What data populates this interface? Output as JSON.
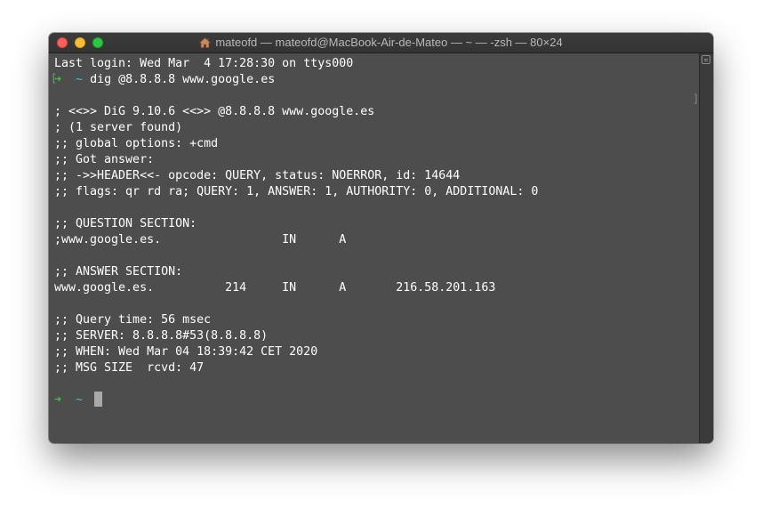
{
  "window": {
    "title": "mateofd — mateofd@MacBook-Air-de-Mateo — ~ — -zsh — 80×24",
    "title_icon": "home-icon"
  },
  "colors": {
    "background": "#4d4d4d",
    "text": "#ffffff",
    "prompt_arrow": "#39c639",
    "prompt_dir": "#39c6d8"
  },
  "terminal": {
    "last_login": "Last login: Wed Mar  4 17:28:30 on ttys000",
    "prompt_arrow": "➜",
    "prompt_dir": "~",
    "command": "dig @8.8.8.8 www.google.es",
    "output": [
      "; <<>> DiG 9.10.6 <<>> @8.8.8.8 www.google.es",
      "; (1 server found)",
      ";; global options: +cmd",
      ";; Got answer:",
      ";; ->>HEADER<<- opcode: QUERY, status: NOERROR, id: 14644",
      ";; flags: qr rd ra; QUERY: 1, ANSWER: 1, AUTHORITY: 0, ADDITIONAL: 0",
      ";; QUESTION SECTION:",
      ";www.google.es.                 IN      A",
      ";; ANSWER SECTION:",
      "www.google.es.          214     IN      A       216.58.201.163",
      ";; Query time: 56 msec",
      ";; SERVER: 8.8.8.8#53(8.8.8.8)",
      ";; WHEN: Wed Mar 04 18:39:42 CET 2020",
      ";; MSG SIZE  rcvd: 47"
    ],
    "mark_left": "[",
    "mark_right": "]"
  }
}
